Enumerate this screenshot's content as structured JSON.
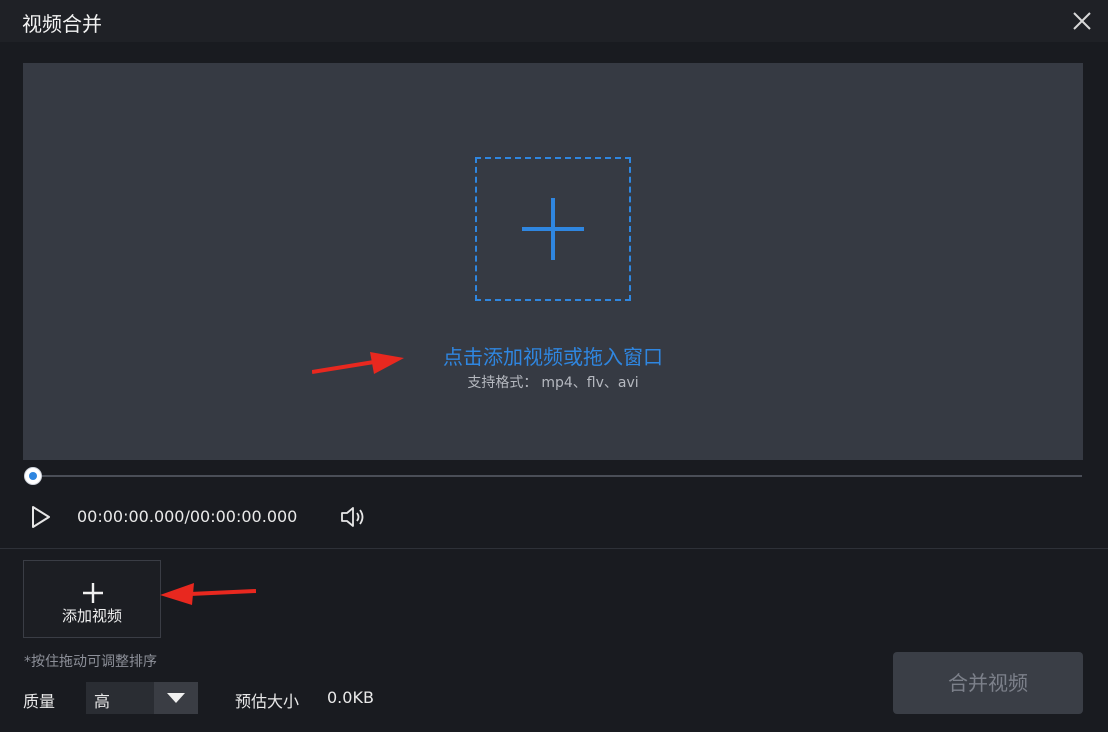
{
  "window": {
    "title": "视频合并",
    "close_icon": "close-icon"
  },
  "preview": {
    "add_icon": "plus-icon",
    "drop_hint": "点击添加视频或拖入窗口",
    "formats_label": "支持格式：",
    "formats_value": "mp4、flv、avi"
  },
  "player": {
    "seek_progress": 0,
    "timecode": "00:00:00.000/00:00:00.000",
    "play_icon": "play-icon",
    "volume_icon": "volume-icon"
  },
  "clips": {
    "add_label": "添加视频",
    "add_icon": "plus-icon",
    "drag_hint": "*按住拖动可调整排序"
  },
  "footer": {
    "quality_label": "质量",
    "quality_value": "高",
    "estimate_label": "预估大小",
    "estimate_value": "0.0KB",
    "merge_button": "合并视频"
  },
  "colors": {
    "accent": "#2f86e0",
    "annotation_arrow": "#e8281f"
  }
}
